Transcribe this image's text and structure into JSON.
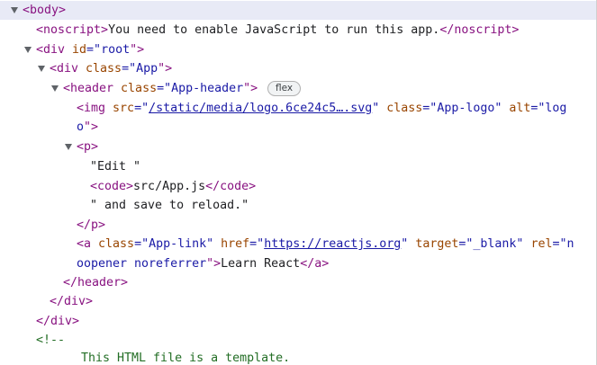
{
  "dom": {
    "body_open": "<body>",
    "noscript_open": "<noscript>",
    "noscript_text": "You need to enable JavaScript to run this app.",
    "noscript_close": "</noscript>",
    "div_root_open_a": "<div ",
    "div_root_attr": "id",
    "div_root_eq": "=\"",
    "div_root_val": "root",
    "div_root_end": "\">",
    "div_app_open_a": "<div ",
    "div_app_attr": "class",
    "div_app_eq": "=\"",
    "div_app_val": "App",
    "div_app_end": "\">",
    "header_open_a": "<header ",
    "header_attr": "class",
    "header_eq": "=\"",
    "header_val": "App-header",
    "header_end": "\">",
    "header_badge": "flex",
    "img_open_a": "<img ",
    "img_src_attr": "src",
    "img_src_eq": "=\"",
    "img_src_val": "/static/media/logo.6ce24c5….svg",
    "img_src_end": "\" ",
    "img_class_attr": "class",
    "img_class_eq": "=\"",
    "img_class_val": "App-logo",
    "img_class_end": "\" ",
    "img_alt_attr": "alt",
    "img_alt_eq": "=\"",
    "img_alt_val_1": "log",
    "img_alt_val_2": "o",
    "img_alt_end": "\">",
    "p_open": "<p>",
    "p_text_1": "\"Edit \"",
    "code_open": "<code>",
    "code_text": "src/App.js",
    "code_close": "</code>",
    "p_text_2": "\" and save to reload.\"",
    "p_close": "</p>",
    "a_open_a": "<a ",
    "a_class_attr": "class",
    "a_class_eq": "=\"",
    "a_class_val": "App-link",
    "a_class_end": "\" ",
    "a_href_attr": "href",
    "a_href_eq": "=\"",
    "a_href_val": "https://reactjs.org",
    "a_href_end": "\" ",
    "a_target_attr": "target",
    "a_target_eq": "=\"",
    "a_target_val": "_blank",
    "a_target_end": "\" ",
    "a_rel_attr": "rel",
    "a_rel_eq": "=\"",
    "a_rel_val_1": "n",
    "a_rel_val_2": "oopener noreferrer",
    "a_rel_end": "\">",
    "a_text": "Learn React",
    "a_close": "</a>",
    "header_close": "</header>",
    "div_app_close": "</div>",
    "div_root_close": "</div>",
    "comment_open": "<!--",
    "comment_text": "This HTML file is a template."
  },
  "colors": {
    "tag": "#881280",
    "attribute": "#994500",
    "value": "#1a1aa6",
    "comment": "#236e25",
    "selected_row": "#e8eaf6"
  }
}
